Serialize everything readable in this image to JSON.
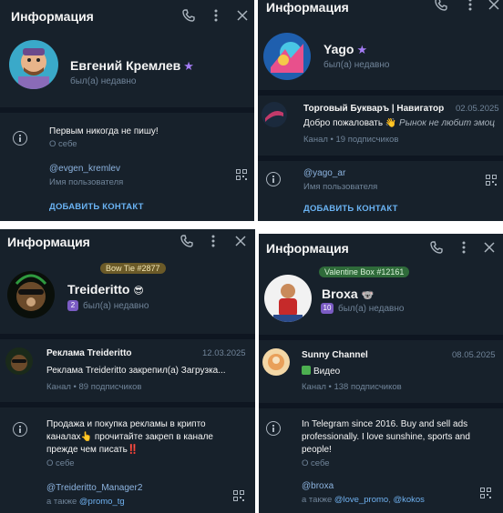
{
  "panels": [
    {
      "header_title": "Информация",
      "name": "Евгений Кремлев",
      "status": "был(а) недавно",
      "bio": "Первым никогда не пишу!",
      "bio_label": "О себе",
      "username": "@evgen_kremlev",
      "username_label": "Имя пользователя",
      "add_contact": "ДОБАВИТЬ КОНТАКТ"
    },
    {
      "header_title": "Информация",
      "name": "Yago",
      "status": "был(а) недавно",
      "channel": {
        "title": "Торговый Букваръ | Навигатор",
        "date": "02.05.2025",
        "message": "Добро пожаловать 👋",
        "message_italic": "Рынок не любит эмоц",
        "subtitle": "Канал • 19 подписчиков"
      },
      "username": "@yago_ar",
      "username_label": "Имя пользователя",
      "add_contact": "ДОБАВИТЬ КОНТАКТ"
    },
    {
      "header_title": "Информация",
      "gift_label": "Bow Tie #2877",
      "name": "Treideritto",
      "level_badge": "2",
      "status": "был(а) недавно",
      "channel": {
        "title": "Реклама Treideritto",
        "date": "12.03.2025",
        "message": "Реклама Treideritto закрепил(а) Загрузка...",
        "subtitle": "Канал • 89 подписчиков"
      },
      "bio_line1": "Продажа и покупка рекламы в крипто",
      "bio_line2": "каналах👆 прочитайте закреп в канале",
      "bio_line3": "прежде чем писать‼️",
      "bio_label": "О себе",
      "username": "@Treideritto_Manager2",
      "also_prefix": "а также",
      "also_link": "@promo_tg"
    },
    {
      "header_title": "Информация",
      "gift_label": "Valentine Box #12161",
      "name": "Broxa",
      "level_badge": "10",
      "status": "был(а) недавно",
      "channel": {
        "title": "Sunny Channel",
        "date": "08.05.2025",
        "message": "Видео",
        "subtitle": "Канал • 138 подписчиков"
      },
      "bio_line1": "In Telegram since 2016. Buy and sell ads",
      "bio_line2": "professionally. I love sunshine, sports and",
      "bio_line3": "people!",
      "bio_label": "О себе",
      "username": "@broxa",
      "also_prefix": "а также",
      "also_link1": "@love_promo",
      "also_link2": "@kokos"
    }
  ],
  "colors": {
    "panel_bg": "#17212b",
    "separator": "#0e1621",
    "accent": "#6ab3f3",
    "muted": "#708499",
    "premium_star": "#a47cf5"
  },
  "icons": [
    "phone-icon",
    "more-vertical-icon",
    "close-icon",
    "info-icon",
    "qr-code-icon",
    "premium-star-icon"
  ]
}
